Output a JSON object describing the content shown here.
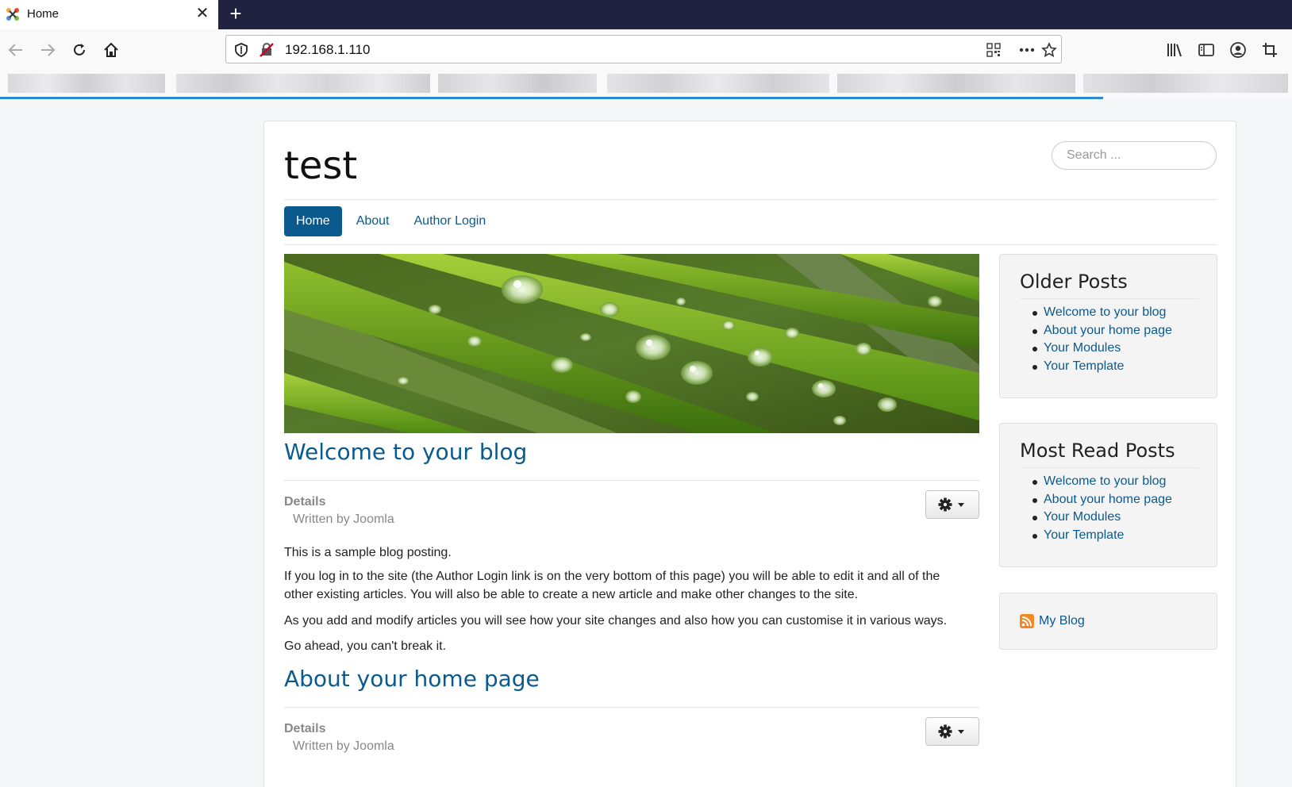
{
  "browser": {
    "tab_title": "Home",
    "url": "192.168.1.110"
  },
  "site": {
    "brand": "test",
    "search_placeholder": "Search ...",
    "menu": [
      {
        "label": "Home",
        "active": true
      },
      {
        "label": "About",
        "active": false
      },
      {
        "label": "Author Login",
        "active": false
      }
    ]
  },
  "articles": [
    {
      "title": "Welcome to your blog",
      "details_label": "Details",
      "written_by": "Written by Joomla",
      "paragraphs": [
        "This is a sample blog posting.",
        "If you log in to the site (the Author Login link is on the very bottom of this page) you will be able to edit it and all of the other existing articles. You will also be able to create a new article and make other changes to the site.",
        "As you add and modify articles you will see how your site changes and also how you can customise it in various ways.",
        "Go ahead, you can't break it."
      ]
    },
    {
      "title": "About your home page",
      "details_label": "Details",
      "written_by": "Written by Joomla"
    }
  ],
  "sidebar": {
    "older_posts": {
      "title": "Older Posts",
      "items": [
        "Welcome to your blog",
        "About your home page",
        "Your Modules",
        "Your Template"
      ]
    },
    "most_read": {
      "title": "Most Read Posts",
      "items": [
        "Welcome to your blog",
        "About your home page",
        "Your Modules",
        "Your Template"
      ]
    },
    "feed": {
      "label": "My Blog",
      "icon": "rss-feed-icon"
    }
  },
  "colors": {
    "link": "#0b5a8e",
    "tabbar": "#202340",
    "active_menu": "#0b5a8e"
  }
}
